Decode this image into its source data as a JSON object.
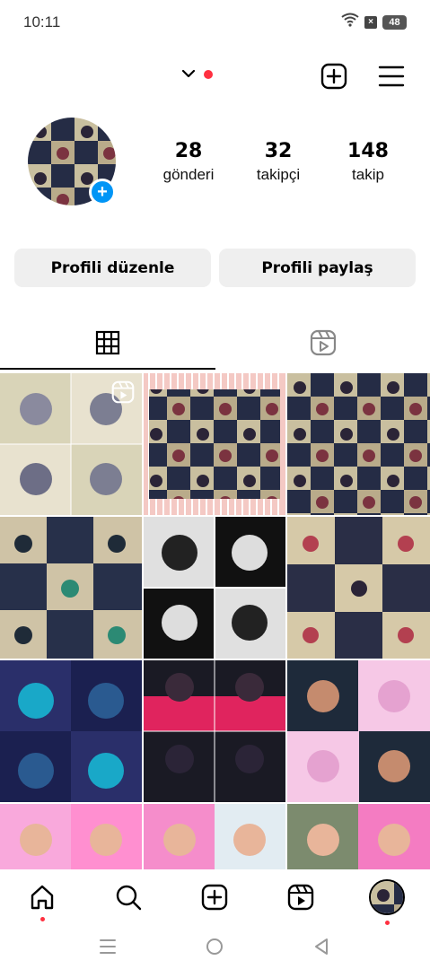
{
  "status_bar": {
    "time": "10:11",
    "battery": "48"
  },
  "profile": {
    "posts_count": "28",
    "posts_label": "gönderi",
    "followers_count": "32",
    "followers_label": "takipçi",
    "following_count": "148",
    "following_label": "takip"
  },
  "actions": {
    "edit_label": "Profili düzenle",
    "share_label": "Profili paylaş"
  },
  "tabs": [
    {
      "icon": "grid-icon",
      "active": true
    },
    {
      "icon": "reels-icon",
      "active": false
    }
  ],
  "colors": {
    "accent": "#0095f6",
    "notification": "#ff3040",
    "button_bg": "#efefef"
  },
  "bottom_nav": [
    "home-icon",
    "search-icon",
    "create-icon",
    "reels-icon",
    "profile-avatar"
  ]
}
